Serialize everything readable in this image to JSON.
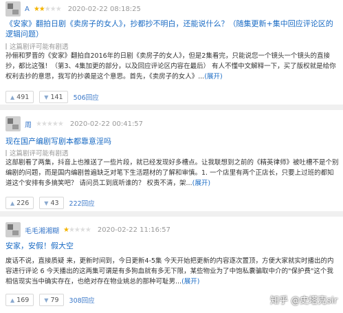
{
  "reviews": [
    {
      "user": "A",
      "stars_filled": 2,
      "date": "2020-02-22 08:18:25",
      "title": "《安家》翻拍日剧《卖房子的女人》，抄都抄不明白，还能说什么？（随集更新+集中回应评论区的逻辑问题）",
      "spoiler": "这篇剧评可能有剧透",
      "body": "孙俪和罗晋的《安家》翻拍自2016年的日剧《卖房子的女人》，但是2集看完，只能说您一个镜头一个镜头的直接抄，都比这强！（第3、4集加更的部分，以及回应评论区内容在最后） 有人不懂中文解释一下，买了版权就是给你权利去抄的意思，我写的抄袭是这个意思。首先，《卖房子的女人》...",
      "more": "(展开)",
      "up": "491",
      "down": "141",
      "replies": "506回应"
    },
    {
      "user": "周",
      "stars_filled": 0,
      "date": "2020-02-22 00:41:57",
      "title": "现在国产编剧写剧本都靠意淫吗",
      "spoiler": "这篇剧评可能有剧透",
      "body": "这部剧看了两集，抖音上也推送了一些片段，就已经发现好多槽点。让我联想到之前的《精英律师》被吐槽不是个别编剧的问题，而是国内编剧普遍缺乏对笔下生活题材的了解和审慎。1. 一个店里有两个正店长，只要上过班的都知道这个安排有多搞笑吧？ 请问员工到底听谁的？ 权责不清，架...",
      "more": "(展开)",
      "up": "226",
      "down": "43",
      "replies": "222回应"
    },
    {
      "user": "毛毛湘湘糊",
      "stars_filled": 1,
      "date": "2020-02-22 11:16:57",
      "title": "安家，安假！假大空",
      "spoiler": "",
      "body": "废话不说，直接质疑 来，更新时间到，今日更新4-5集 今天开始把更新的内容逐次置顶，方便大家就实时播出的内容进行评论 6 今天播出的这两集可谓是有多狗血就有多无下限，某些物业为了中饱私囊骗取中介的\"保护费\"这个我相信现实当中确实存在，也绝对存在物业姚总的那种可耻男...",
      "more": "(展开)",
      "up": "169",
      "down": "79",
      "replies": "308回应"
    }
  ],
  "watermark": "知乎 @史塔克sir"
}
